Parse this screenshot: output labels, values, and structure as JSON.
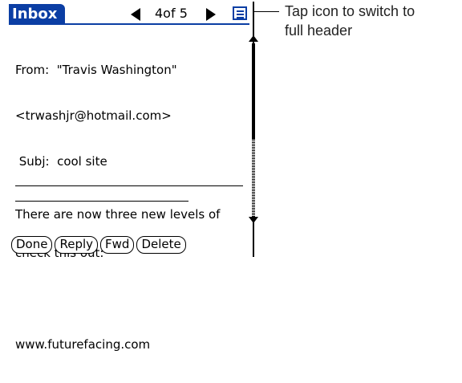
{
  "titlebar": {
    "title": "Inbox",
    "message_counter": "4of 5"
  },
  "message": {
    "lines": [
      "From:  \"Travis Washington\"",
      "<trwashjr@hotmail.com>",
      " Subj:  cool site",
      "",
      "check this out:",
      "",
      "www.futurefacing.com"
    ],
    "last_line": "There are now three new levels of"
  },
  "buttons": {
    "done": "Done",
    "reply": "Reply",
    "fwd": "Fwd",
    "delete": "Delete"
  },
  "callout": {
    "line1": "Tap icon to switch to",
    "line2": "full header"
  },
  "colors": {
    "accent": "#0b3ea4"
  },
  "icons": {
    "prev": "left-arrow-icon",
    "next": "right-arrow-icon",
    "header_toggle": "header-toggle-icon",
    "scroll_up": "scroll-up-arrow-icon",
    "scroll_down": "scroll-down-arrow-icon"
  }
}
